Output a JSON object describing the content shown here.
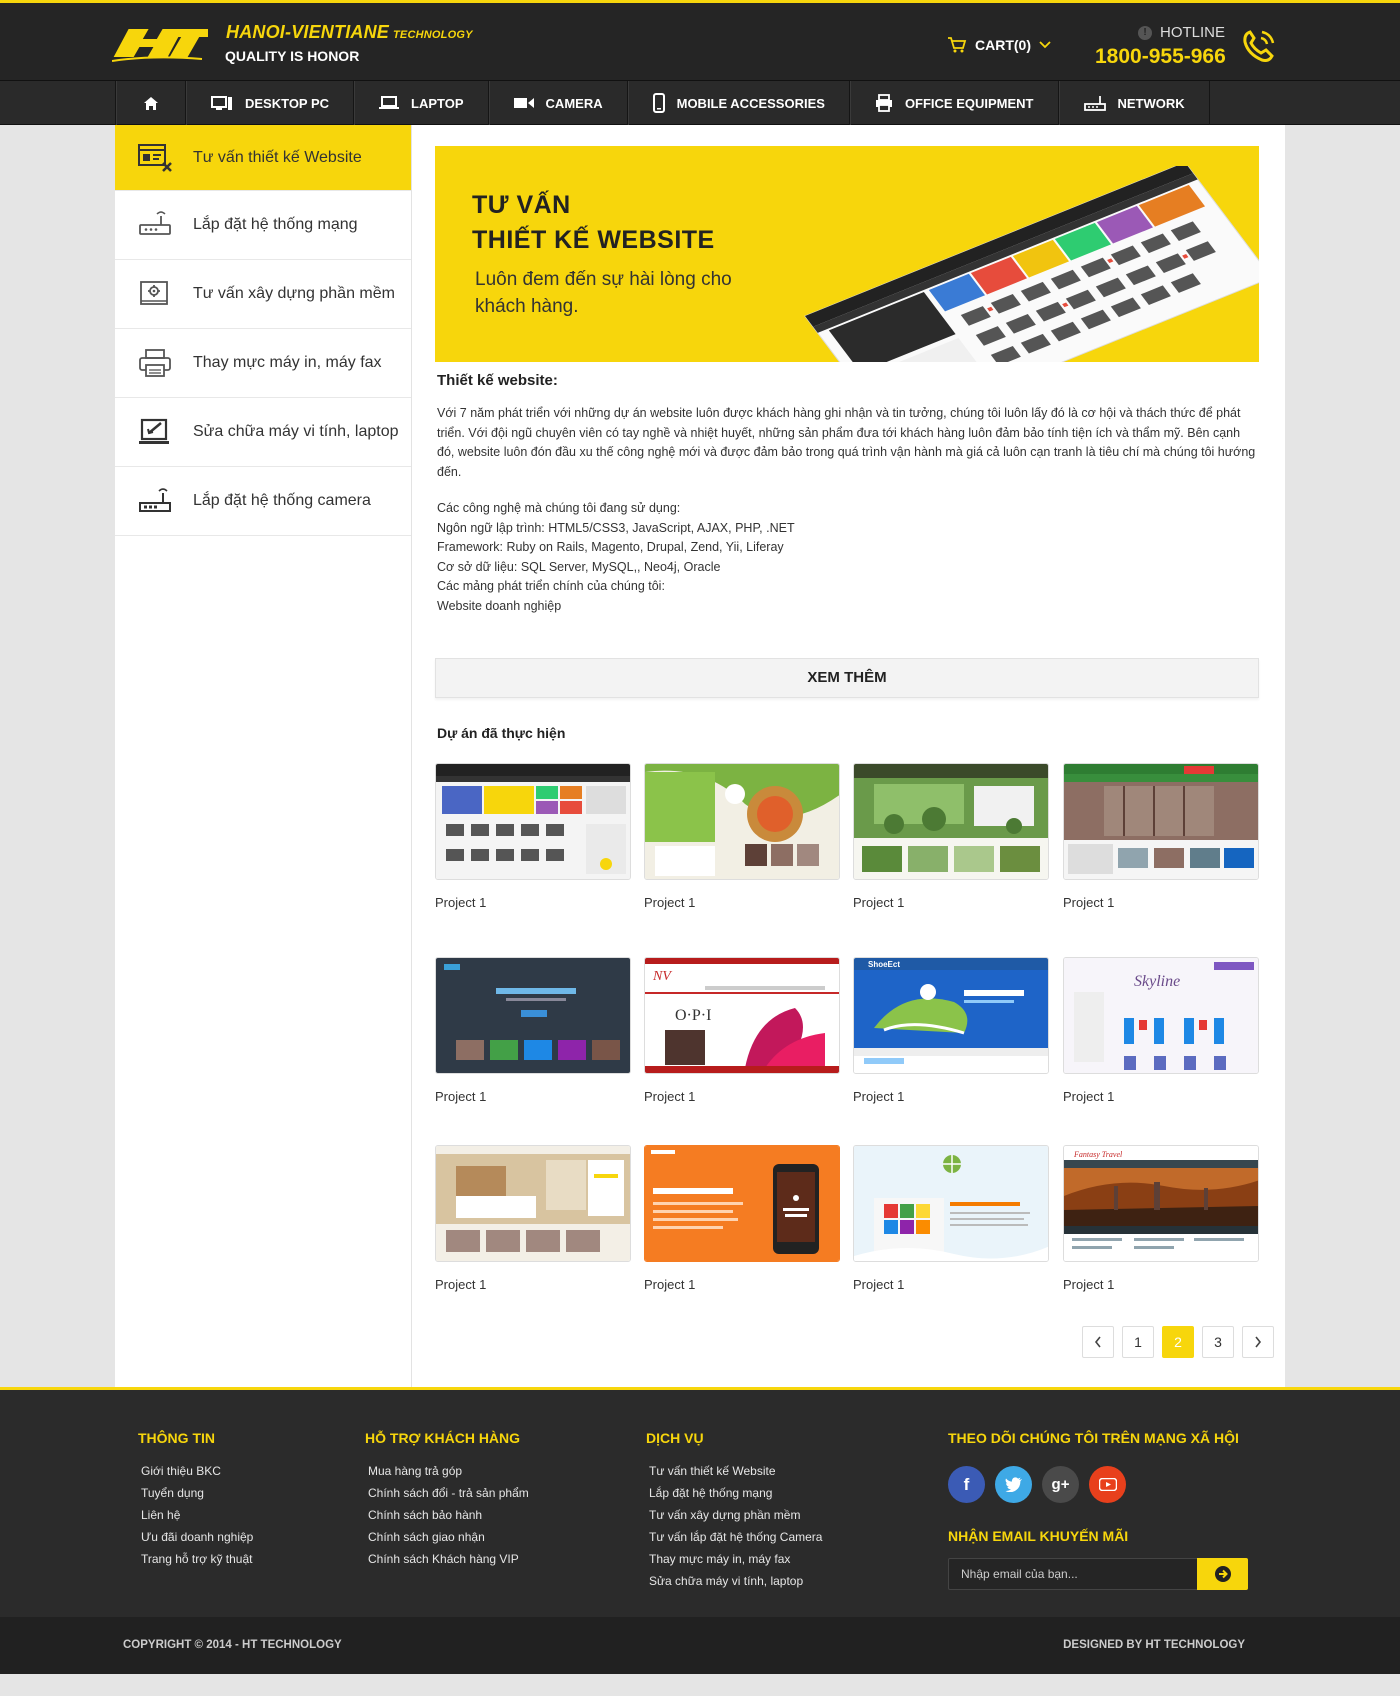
{
  "brand": {
    "name": "HANOI-VIENTIANE",
    "name_suffix": "TECHNOLOGY",
    "tagline": "QUALITY IS HONOR",
    "color": "#f7d60c"
  },
  "header": {
    "cart_label": "CART(0)",
    "hotline_label": "HOTLINE",
    "hotline_number": "1800-955-966"
  },
  "nav": {
    "items": [
      {
        "label": "",
        "icon": "home-icon"
      },
      {
        "label": "DESKTOP PC",
        "icon": "desktop-icon"
      },
      {
        "label": "LAPTOP",
        "icon": "laptop-icon"
      },
      {
        "label": "CAMERA",
        "icon": "camera-icon"
      },
      {
        "label": "MOBILE ACCESSORIES",
        "icon": "mobile-icon"
      },
      {
        "label": "OFFICE EQUIPMENT",
        "icon": "printer-icon"
      },
      {
        "label": "NETWORK",
        "icon": "router-icon"
      }
    ]
  },
  "sidebar": {
    "items": [
      {
        "label": "Tư vấn thiết kế Website",
        "icon": "web-design-icon",
        "active": true
      },
      {
        "label": "Lắp đặt hệ thống mạng",
        "icon": "router-icon"
      },
      {
        "label": "Tư vấn xây dựng phần mềm",
        "icon": "software-icon"
      },
      {
        "label": "Thay mực máy in, máy fax",
        "icon": "printer-icon"
      },
      {
        "label": "Sửa chữa máy vi tính, laptop",
        "icon": "monitor-repair-icon"
      },
      {
        "label": "Lắp đặt hệ thống camera",
        "icon": "camera-system-icon"
      }
    ]
  },
  "banner": {
    "title_line1": "TƯ VẤN",
    "title_line2": "THIẾT KẾ WEBSITE",
    "subtitle": "Luôn đem đến sự hài lòng cho khách hàng."
  },
  "content": {
    "section_title": "Thiết kế website:",
    "paragraph": "Với 7 năm phát triển với những dự án website luôn được khách hàng ghi nhận và tin tưởng, chúng tôi luôn lấy đó là cơ hội và thách thức để phát triển. Với đội ngũ chuyên viên có tay nghề và nhiệt huyết, những sản phẩm đưa tới khách hàng luôn đảm bảo tính tiện ích và thẩm mỹ. Bên cạnh đó, website luôn đón đầu xu thế công nghệ mới và được đảm bảo trong quá trình vận hành mà giá cả luôn cạn tranh là tiêu chí mà chúng tôi hướng đến.",
    "lines": [
      "Các công nghệ mà chúng tôi đang sử dụng:",
      "Ngôn ngữ lập trình: HTML5/CSS3, JavaScript, AJAX, PHP, .NET",
      "Framework: Ruby on Rails, Magento, Drupal, Zend, Yii, Liferay",
      "Cơ sở dữ liệu: SQL Server, MySQL,, Neo4j, Oracle",
      "Các mảng phát triển chính của chúng tôi:",
      "Website doanh nghiệp"
    ],
    "more_button": "XEM THÊM",
    "projects_title": "Dự án đã thực hiện"
  },
  "projects": [
    {
      "label": "Project 1"
    },
    {
      "label": "Project 1"
    },
    {
      "label": "Project 1"
    },
    {
      "label": "Project 1"
    },
    {
      "label": "Project 1"
    },
    {
      "label": "Project 1"
    },
    {
      "label": "Project 1"
    },
    {
      "label": "Project 1"
    },
    {
      "label": "Project 1"
    },
    {
      "label": "Project 1"
    },
    {
      "label": "Project 1"
    },
    {
      "label": "Project 1"
    }
  ],
  "pagination": {
    "pages": [
      "1",
      "2",
      "3"
    ],
    "current": "2"
  },
  "footer": {
    "col1": {
      "title": "THÔNG TIN",
      "items": [
        "Giới thiệu BKC",
        "Tuyển dụng",
        "Liên hệ",
        "Ưu đãi doanh nghiệp",
        "Trang hỗ trợ kỹ thuật"
      ]
    },
    "col2": {
      "title": "HỖ TRỢ KHÁCH HÀNG",
      "items": [
        "Mua hàng trả góp",
        "Chính sách đổi - trả sản phẩm",
        "Chính sách bảo hành",
        "Chính sách giao nhận",
        "Chính sách Khách hàng VIP"
      ]
    },
    "col3": {
      "title": "DỊCH VỤ",
      "items": [
        "Tư vấn thiết kế Website",
        "Lắp đặt hệ thống mạng",
        "Tư vấn xây dựng phần mềm",
        "Tư vấn lắp đặt hệ thống Camera",
        "Thay mực máy in, máy fax",
        "Sửa chữa máy vi tính, laptop"
      ]
    },
    "social_title": "THEO DÕI CHÚNG TÔI TRÊN MẠNG XÃ HỘI",
    "social": [
      {
        "icon": "facebook-icon",
        "glyph": "f",
        "color": "#3b5bb5"
      },
      {
        "icon": "twitter-icon",
        "glyph": "t",
        "color": "#3ea9e6"
      },
      {
        "icon": "google-plus-icon",
        "glyph": "g+",
        "color": "#4a4a4a"
      },
      {
        "icon": "youtube-icon",
        "glyph": "▶",
        "color": "#e8401c"
      }
    ],
    "email_title": "NHẬN EMAIL KHUYẾN MÃI",
    "email_placeholder": "Nhập email của bạn..."
  },
  "bottom": {
    "copyright": "COPYRIGHT © 2014 - HT TECHNOLOGY",
    "designed": "DESIGNED BY HT TECHNOLOGY"
  }
}
